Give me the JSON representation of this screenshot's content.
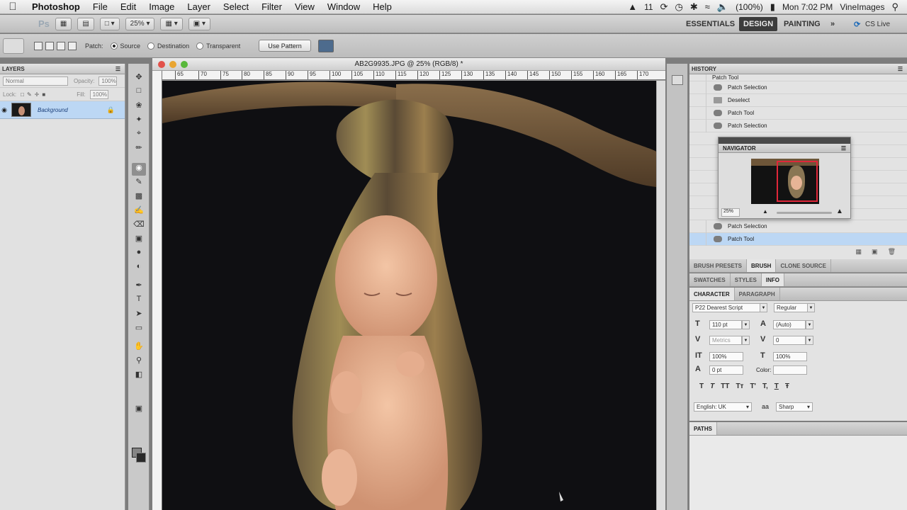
{
  "menubar": {
    "app_name": "Photoshop",
    "menus": [
      "File",
      "Edit",
      "Image",
      "Layer",
      "Select",
      "Filter",
      "View",
      "Window",
      "Help"
    ],
    "status_adobe": "11",
    "battery": "(100%)",
    "clock": "Mon 7:02 PM",
    "user": "VineImages"
  },
  "appbar": {
    "ps": "Ps",
    "zoom": "25%",
    "workspaces": [
      "ESSENTIALS",
      "DESIGN",
      "PAINTING"
    ],
    "more": "»",
    "cslive": "CS Live"
  },
  "options": {
    "patch_label": "Patch:",
    "source_label": "Source",
    "destination_label": "Destination",
    "transparent_label": "Transparent",
    "use_pattern_label": "Use Pattern"
  },
  "layers": {
    "title": "LAYERS",
    "blend_mode": "Normal",
    "opacity_label": "Opacity:",
    "opacity_value": "100%",
    "lock_label": "Lock:",
    "fill_label": "Fill:",
    "fill_value": "100%",
    "layer_name": "Background"
  },
  "document": {
    "title": "AB2G9935.JPG @ 25% (RGB/8) *",
    "ruler_ticks": [
      "65",
      "70",
      "75",
      "80",
      "85",
      "90",
      "95",
      "100",
      "105",
      "110",
      "115",
      "120",
      "125",
      "130",
      "135",
      "140",
      "145",
      "150",
      "155",
      "160",
      "165",
      "170"
    ]
  },
  "history": {
    "title": "HISTORY",
    "partial_top": "Patch Tool",
    "items": [
      "Patch Selection",
      "Deselect",
      "Patch Tool",
      "Patch Selection"
    ],
    "bottom_items": [
      "Patch Selection",
      "Patch Tool"
    ]
  },
  "navigator": {
    "title": "NAVIGATOR",
    "zoom": "25%"
  },
  "brush_tabs": [
    "BRUSH PRESETS",
    "BRUSH",
    "CLONE SOURCE"
  ],
  "info_tabs": [
    "SWATCHES",
    "STYLES",
    "INFO"
  ],
  "char_tabs": [
    "CHARACTER",
    "PARAGRAPH"
  ],
  "character": {
    "font_family": "P22 Dearest Script",
    "font_style": "Regular",
    "size": "110 pt",
    "leading": "(Auto)",
    "kerning": "Metrics",
    "tracking": "0",
    "vscale": "100%",
    "hscale": "100%",
    "baseline": "0 pt",
    "color_label": "Color:",
    "style_buttons": [
      "T",
      "T",
      "TT",
      "Tт",
      "T'",
      "T,",
      "T",
      "Ŧ"
    ],
    "language": "English: UK",
    "aa_label": "aa",
    "antialias": "Sharp"
  },
  "paths": {
    "title": "PATHS"
  }
}
